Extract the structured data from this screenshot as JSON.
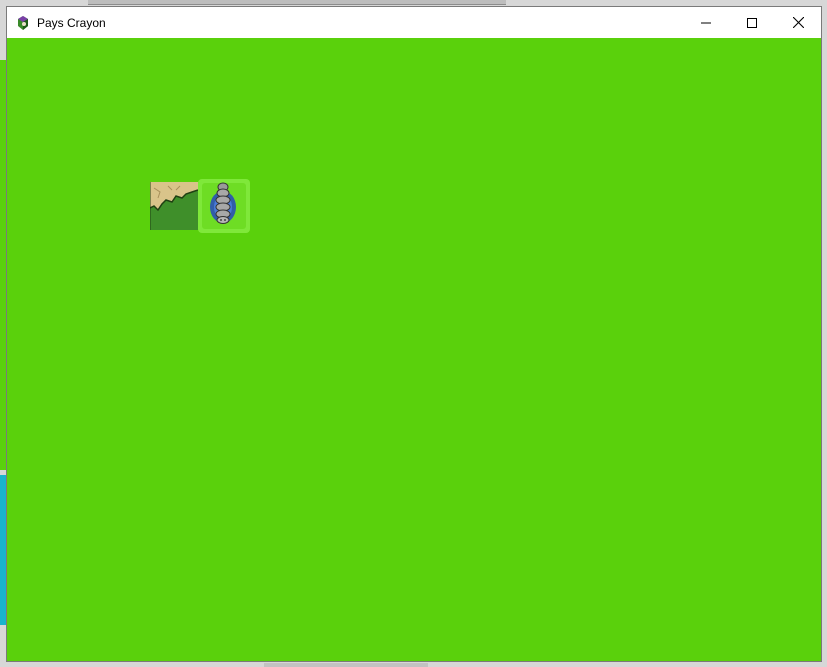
{
  "window": {
    "title": "Pays Crayon",
    "app_icon": "crayon-app-icon",
    "controls": {
      "minimize_icon": "minimize-icon",
      "maximize_icon": "maximize-icon",
      "close_icon": "close-icon"
    }
  },
  "game": {
    "background_color": "#5ad10c",
    "tiles": [
      {
        "kind": "terrain",
        "icon": "sand-grass-tile"
      },
      {
        "kind": "player",
        "icon": "caterpillar-player-icon"
      }
    ]
  }
}
